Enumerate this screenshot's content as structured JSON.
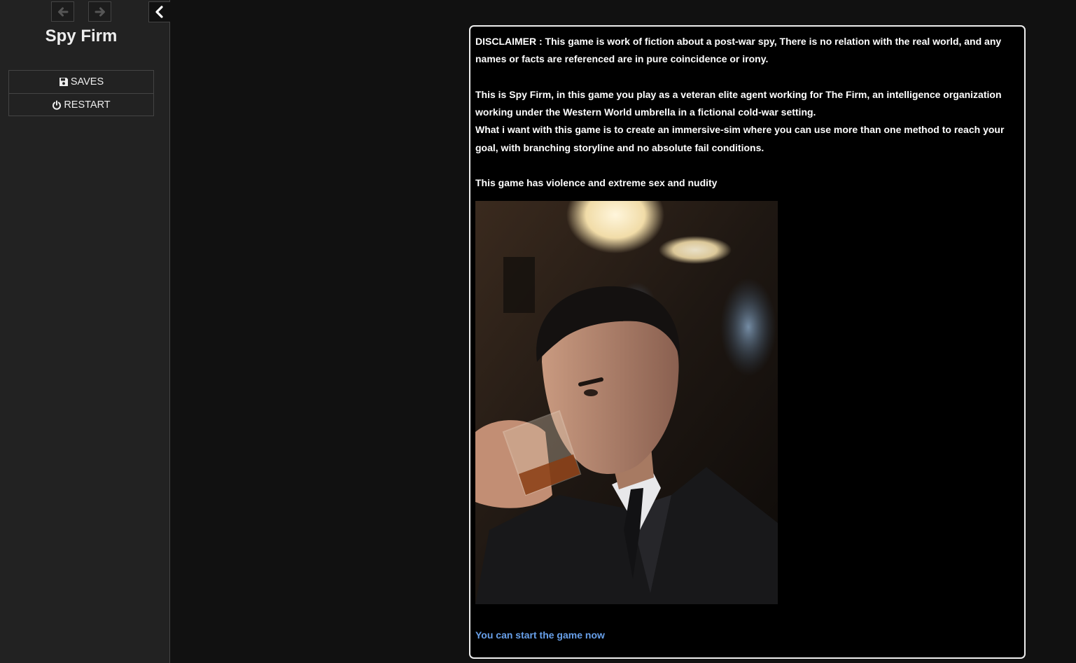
{
  "sidebar": {
    "title": "Spy Firm",
    "history_back_icon": "arrow-left-icon",
    "history_forward_icon": "arrow-right-icon",
    "stow_icon": "chevron-left-icon",
    "menu": [
      {
        "label": "SAVES",
        "icon": "floppy-disk-icon"
      },
      {
        "label": "RESTART",
        "icon": "power-icon"
      }
    ]
  },
  "passage": {
    "disclaimer": "DISCLAIMER : This game is work of fiction about a post-war spy, There is no relation with the real world, and any names or facts are referenced are in pure coincidence or irony.",
    "intro": "This is Spy Firm, in this game you play as a veteran elite agent working for The Firm, an intelligence organization working under the Western World umbrella in a fictional cold-war setting.",
    "goal": "What i want with this game is to create an immersive-sim where you can use more than one method to reach your goal, with branching storyline and no absolute fail conditions.",
    "warning": "This game has violence and extreme sex and nudity",
    "start_link": "You can start the game now"
  },
  "colors": {
    "background": "#111111",
    "sidebar": "#222222",
    "passage_bg": "#000000",
    "passage_border": "#eeeeee",
    "link": "#68a0ea"
  }
}
